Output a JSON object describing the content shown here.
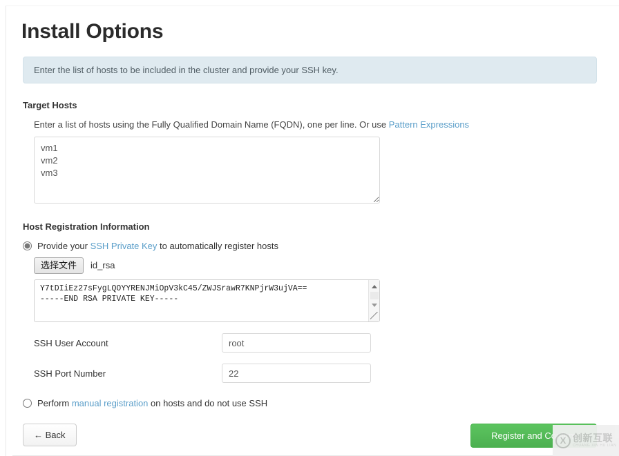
{
  "page": {
    "title": "Install Options"
  },
  "info_banner": {
    "text": "Enter the list of hosts to be included in the cluster and provide your SSH key."
  },
  "target_hosts": {
    "heading": "Target Hosts",
    "helper_prefix": "Enter a list of hosts using the Fully Qualified Domain Name (FQDN), one per line. Or use ",
    "helper_link": "Pattern Expressions",
    "hosts_value": "vm1\nvm2\nvm3",
    "hosts_placeholder": ""
  },
  "host_registration": {
    "heading": "Host Registration Information",
    "ssh_option": {
      "prefix": "Provide your ",
      "link": "SSH Private Key",
      "suffix": " to automatically register hosts",
      "selected": true
    },
    "file_picker": {
      "button_label": "选择文件",
      "file_name": "id_rsa"
    },
    "private_key_value": "Y7tDIiEz27sFygLQOYYRENJMiOpV3kC45/ZWJSrawR7KNPjrW3ujVA==\n-----END RSA PRIVATE KEY-----",
    "fields": [
      {
        "label": "SSH User Account",
        "value": "root"
      },
      {
        "label": "SSH Port Number",
        "value": "22"
      }
    ],
    "manual_option": {
      "prefix": "Perform ",
      "link": "manual registration",
      "suffix": " on hosts and do not use SSH",
      "selected": false
    }
  },
  "footer": {
    "back_label": "← Back",
    "register_label": "Register and Confirm"
  },
  "watermark": {
    "mark": "X",
    "chinese": "创新互联",
    "english": "CHUANG XIN HU LIAN"
  },
  "colors": {
    "accent_link": "#5a9ec9",
    "banner_bg": "#dfeaf0",
    "primary_button": "#4cb050",
    "title": "#2b2b2b"
  }
}
